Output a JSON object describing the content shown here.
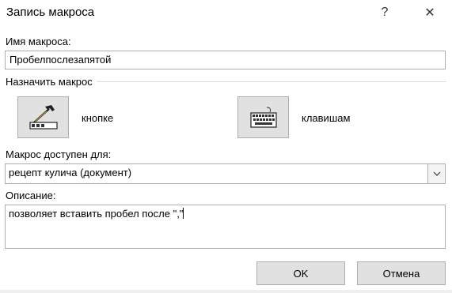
{
  "window": {
    "title": "Запись макроса",
    "help_label": "?",
    "close_label": "✕"
  },
  "macro_name": {
    "label": "Имя макроса:",
    "value": "Пробелпослезапятой"
  },
  "assign": {
    "label": "Назначить макрос",
    "button_label": "кнопке",
    "keyboard_label": "клавишам"
  },
  "available": {
    "label": "Макрос доступен для:",
    "selected": "рецепт кулича (документ)"
  },
  "description": {
    "label": "Описание:",
    "value": "позволяет вставить пробел после \",\""
  },
  "buttons": {
    "ok": "OK",
    "cancel": "Отмена"
  }
}
